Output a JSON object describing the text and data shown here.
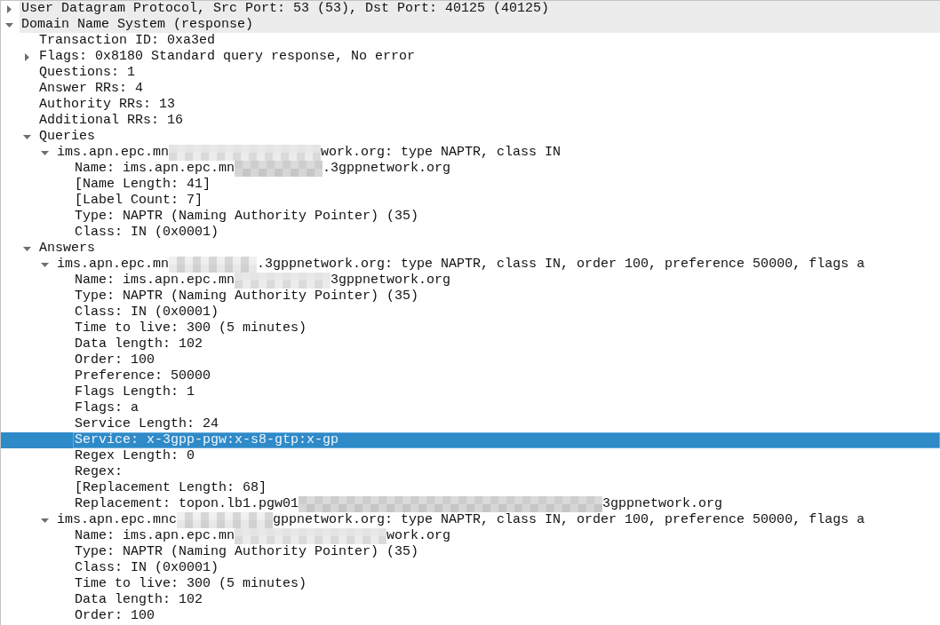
{
  "tree": [
    {
      "label": "User Datagram Protocol, Src Port: 53 (53), Dst Port: 40125 (40125)",
      "expanded": false,
      "selected": false
    },
    {
      "label": "Domain Name System (response)",
      "expanded": true,
      "selected": false,
      "children": [
        {
          "label": "Transaction ID: 0xa3ed",
          "selected": false
        },
        {
          "label": "Flags: 0x8180 Standard query response, No error",
          "expanded": false,
          "selected": false
        },
        {
          "label": "Questions: 1",
          "selected": false
        },
        {
          "label": "Answer RRs: 4",
          "selected": false
        },
        {
          "label": "Authority RRs: 13",
          "selected": false
        },
        {
          "label": "Additional RRs: 16",
          "selected": false
        },
        {
          "label": "Queries",
          "expanded": true,
          "selected": false,
          "children": [
            {
              "segments": [
                {
                  "kind": "text",
                  "text": "ims.apn.epc.mn"
                },
                {
                  "kind": "redacted"
                },
                {
                  "kind": "text",
                  "text": "work.org: type NAPTR, class IN"
                }
              ],
              "expanded": true,
              "selected": false,
              "children": [
                {
                  "segments": [
                    {
                      "kind": "text",
                      "text": "Name: ims.apn.epc.mn"
                    },
                    {
                      "kind": "redacted"
                    },
                    {
                      "kind": "text",
                      "text": ".3gppnetwork.org"
                    }
                  ],
                  "selected": false
                },
                {
                  "label": "[Name Length: 41]",
                  "selected": false
                },
                {
                  "label": "[Label Count: 7]",
                  "selected": false
                },
                {
                  "label": "Type: NAPTR (Naming Authority Pointer) (35)",
                  "selected": false
                },
                {
                  "label": "Class: IN (0x0001)",
                  "selected": false
                }
              ]
            }
          ]
        },
        {
          "label": "Answers",
          "expanded": true,
          "selected": false,
          "children": [
            {
              "segments": [
                {
                  "kind": "text",
                  "text": "ims.apn.epc.mn"
                },
                {
                  "kind": "redacted"
                },
                {
                  "kind": "text",
                  "text": ".3gppnetwork.org: type NAPTR, class IN, order 100, preference 50000, flags a"
                }
              ],
              "expanded": true,
              "selected": false,
              "children": [
                {
                  "segments": [
                    {
                      "kind": "text",
                      "text": "Name: ims.apn.epc.mn"
                    },
                    {
                      "kind": "redacted"
                    },
                    {
                      "kind": "text",
                      "text": "3gppnetwork.org"
                    }
                  ],
                  "selected": false
                },
                {
                  "label": "Type: NAPTR (Naming Authority Pointer) (35)",
                  "selected": false
                },
                {
                  "label": "Class: IN (0x0001)",
                  "selected": false
                },
                {
                  "label": "Time to live: 300 (5 minutes)",
                  "selected": false
                },
                {
                  "label": "Data length: 102",
                  "selected": false
                },
                {
                  "label": "Order: 100",
                  "selected": false
                },
                {
                  "label": "Preference: 50000",
                  "selected": false
                },
                {
                  "label": "Flags Length: 1",
                  "selected": false
                },
                {
                  "label": "Flags: a",
                  "selected": false
                },
                {
                  "label": "Service Length: 24",
                  "selected": false
                },
                {
                  "label": "Service: x-3gpp-pgw:x-s8-gtp:x-gp",
                  "selected": true
                },
                {
                  "label": "Regex Length: 0",
                  "selected": false
                },
                {
                  "label": "Regex:",
                  "selected": false
                },
                {
                  "label": "[Replacement Length: 68]",
                  "selected": false
                },
                {
                  "segments": [
                    {
                      "kind": "text",
                      "text": "Replacement: topon.lb1.pgw01"
                    },
                    {
                      "kind": "redacted"
                    },
                    {
                      "kind": "text",
                      "text": "3gppnetwork.org"
                    }
                  ],
                  "selected": false
                }
              ]
            },
            {
              "segments": [
                {
                  "kind": "text",
                  "text": "ims.apn.epc.mnc"
                },
                {
                  "kind": "redacted"
                },
                {
                  "kind": "text",
                  "text": "gppnetwork.org: type NAPTR, class IN, order 100, preference 50000, flags a"
                }
              ],
              "expanded": true,
              "selected": false,
              "children": [
                {
                  "segments": [
                    {
                      "kind": "text",
                      "text": "Name: ims.apn.epc.mn"
                    },
                    {
                      "kind": "redacted"
                    },
                    {
                      "kind": "text",
                      "text": "work.org"
                    }
                  ],
                  "selected": false
                },
                {
                  "label": "Type: NAPTR (Naming Authority Pointer) (35)",
                  "selected": false
                },
                {
                  "label": "Class: IN (0x0001)",
                  "selected": false
                },
                {
                  "label": "Time to live: 300 (5 minutes)",
                  "selected": false
                },
                {
                  "label": "Data length: 102",
                  "selected": false
                },
                {
                  "label": "Order: 100",
                  "selected": false
                }
              ]
            }
          ]
        }
      ]
    }
  ]
}
